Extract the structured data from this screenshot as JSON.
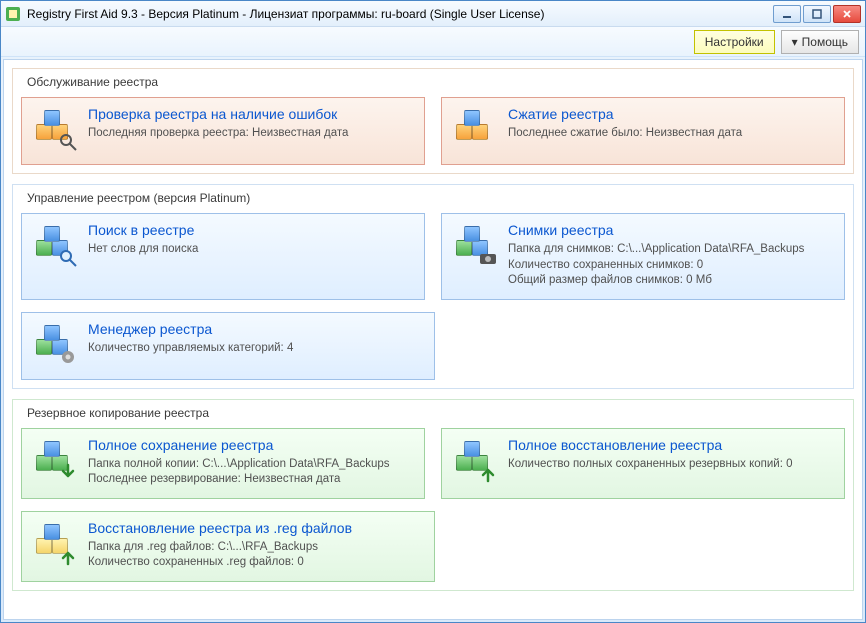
{
  "window": {
    "title": "Registry First Aid 9.3 - Версия Platinum - Лицензиат программы: ru-board (Single User License)"
  },
  "toolbar": {
    "settings": "Настройки",
    "help": "Помощь"
  },
  "sections": {
    "maintenance": {
      "title": "Обслуживание реестра",
      "scan": {
        "title": "Проверка реестра на наличие ошибок",
        "line1": "Последняя проверка реестра: Неизвестная дата"
      },
      "compress": {
        "title": "Сжатие реестра",
        "line1": "Последнее сжатие было: Неизвестная дата"
      }
    },
    "manage": {
      "title": "Управление реестром (версия Platinum)",
      "search": {
        "title": "Поиск в реестре",
        "line1": "Нет слов для поиска"
      },
      "snapshots": {
        "title": "Снимки реестра",
        "line1": "Папка для снимков: C:\\...\\Application Data\\RFA_Backups",
        "line2": "Количество сохраненных снимков: 0",
        "line3": "Общий размер файлов снимков: 0 Мб"
      },
      "manager": {
        "title": "Менеджер реестра",
        "line1": "Количество управляемых категорий: 4"
      }
    },
    "backup": {
      "title": "Резервное копирование реестра",
      "full_save": {
        "title": "Полное сохранение реестра",
        "line1": "Папка полной копии: C:\\...\\Application Data\\RFA_Backups",
        "line2": "Последнее резервирование: Неизвестная дата"
      },
      "full_restore": {
        "title": "Полное восстановление реестра",
        "line1": "Количество полных сохраненных резервных копий: 0"
      },
      "reg_restore": {
        "title": "Восстановление реестра из .reg файлов",
        "line1": "Папка для .reg файлов: C:\\...\\RFA_Backups",
        "line2": "Количество сохраненных .reg файлов: 0"
      }
    }
  }
}
